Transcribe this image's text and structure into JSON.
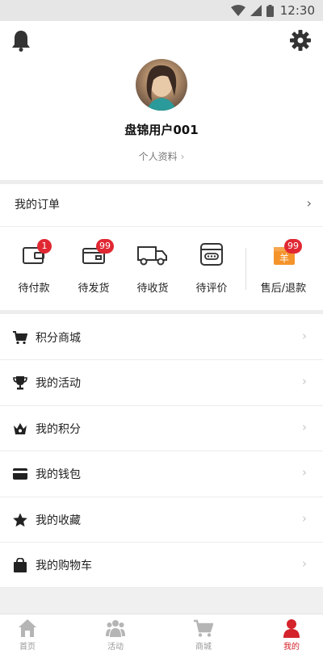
{
  "status_bar": {
    "time": "12:30"
  },
  "header": {
    "username": "盘锦用户001",
    "profile_link": "个人资料"
  },
  "orders": {
    "title": "我的订单",
    "items": [
      {
        "label": "待付款",
        "badge": "1",
        "icon": "wallet-icon"
      },
      {
        "label": "待发货",
        "badge": "99",
        "icon": "package-icon"
      },
      {
        "label": "待收货",
        "badge": "",
        "icon": "truck-icon"
      },
      {
        "label": "待评价",
        "badge": "",
        "icon": "review-icon"
      },
      {
        "label": "售后/退款",
        "badge": "99",
        "icon": "refund-icon"
      }
    ]
  },
  "menu": {
    "items": [
      {
        "label": "积分商城",
        "icon": "cart-icon"
      },
      {
        "label": "我的活动",
        "icon": "trophy-icon"
      },
      {
        "label": "我的积分",
        "icon": "crown-icon"
      },
      {
        "label": "我的钱包",
        "icon": "card-icon"
      },
      {
        "label": "我的收藏",
        "icon": "star-icon"
      },
      {
        "label": "我的购物车",
        "icon": "bag-icon"
      }
    ]
  },
  "bottom_nav": {
    "items": [
      {
        "label": "首页",
        "icon": "home-icon"
      },
      {
        "label": "活动",
        "icon": "group-icon"
      },
      {
        "label": "商城",
        "icon": "shop-cart-icon"
      },
      {
        "label": "我的",
        "icon": "user-icon",
        "active": true
      }
    ]
  },
  "colors": {
    "accent": "#d4232b",
    "badge": "#e02833",
    "refund_icon": "#f5932b"
  }
}
